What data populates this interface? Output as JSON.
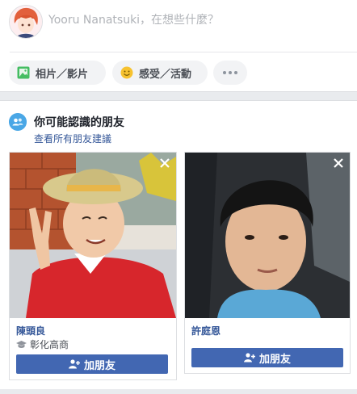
{
  "composer": {
    "placeholder": "Yooru Nanatsuki，在想些什麼？",
    "actions": [
      {
        "label": "相片／影片",
        "icon": "photo-icon"
      },
      {
        "label": "感受／活動",
        "icon": "smiley-icon"
      },
      {
        "label": "",
        "icon": "more-icon"
      }
    ]
  },
  "pymk": {
    "title": "你可能認識的朋友",
    "see_all": "查看所有朋友建議",
    "friends": [
      {
        "name": "陳頭良",
        "school": "彰化高商",
        "add_label": "加朋友"
      },
      {
        "name": "許庭恩",
        "add_label": "加朋友"
      }
    ]
  },
  "colors": {
    "facebook_blue": "#4267b2",
    "link_blue": "#365899",
    "page_bg": "#e9ebee"
  }
}
